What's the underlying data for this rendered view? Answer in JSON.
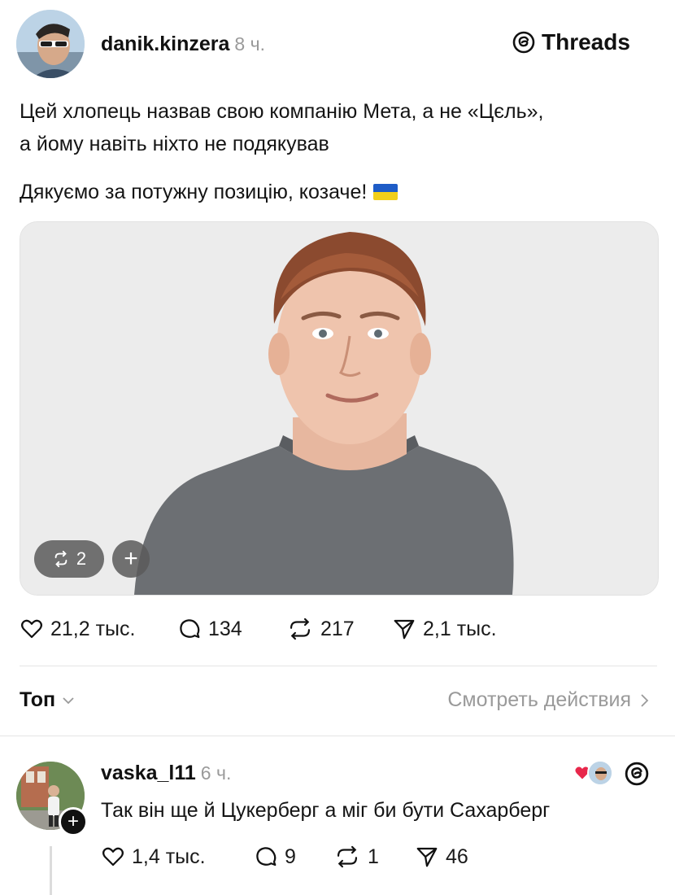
{
  "post": {
    "username": "danik.kinzera",
    "time": "8 ч.",
    "platform": "Threads",
    "line1": "Цей хлопець назвав свою компанію Мета, а не «Цєль»,",
    "line2": "а йому навіть ніхто не подякував",
    "line3": "Дякуємо за потужну позицію, козаче!",
    "media_repost_count": "2",
    "media_plus": "+",
    "stats": {
      "likes": "21,2 тыс.",
      "comments": "134",
      "reposts": "217",
      "shares": "2,1 тыс."
    }
  },
  "sort": {
    "label": "Топ",
    "activity_link": "Смотреть действия"
  },
  "reply": {
    "username": "vaska_l11",
    "time": "6 ч.",
    "text": "Так він ще й Цукерберг а міг би бути Сахарберг",
    "follow_plus": "+",
    "stats": {
      "likes": "1,4 тыс.",
      "comments": "9",
      "reposts": "1",
      "shares": "46"
    }
  },
  "colors": {
    "text": "#111111",
    "muted": "#9a9a9a",
    "like_heart": "#e8274b",
    "flag_blue": "#1e5cc7",
    "flag_yellow": "#f2cf1a"
  },
  "icons": [
    "threads-logo-icon",
    "heart-icon",
    "comment-icon",
    "repost-icon",
    "share-icon",
    "chevron-down-icon",
    "chevron-right-icon",
    "ukraine-flag-icon"
  ]
}
